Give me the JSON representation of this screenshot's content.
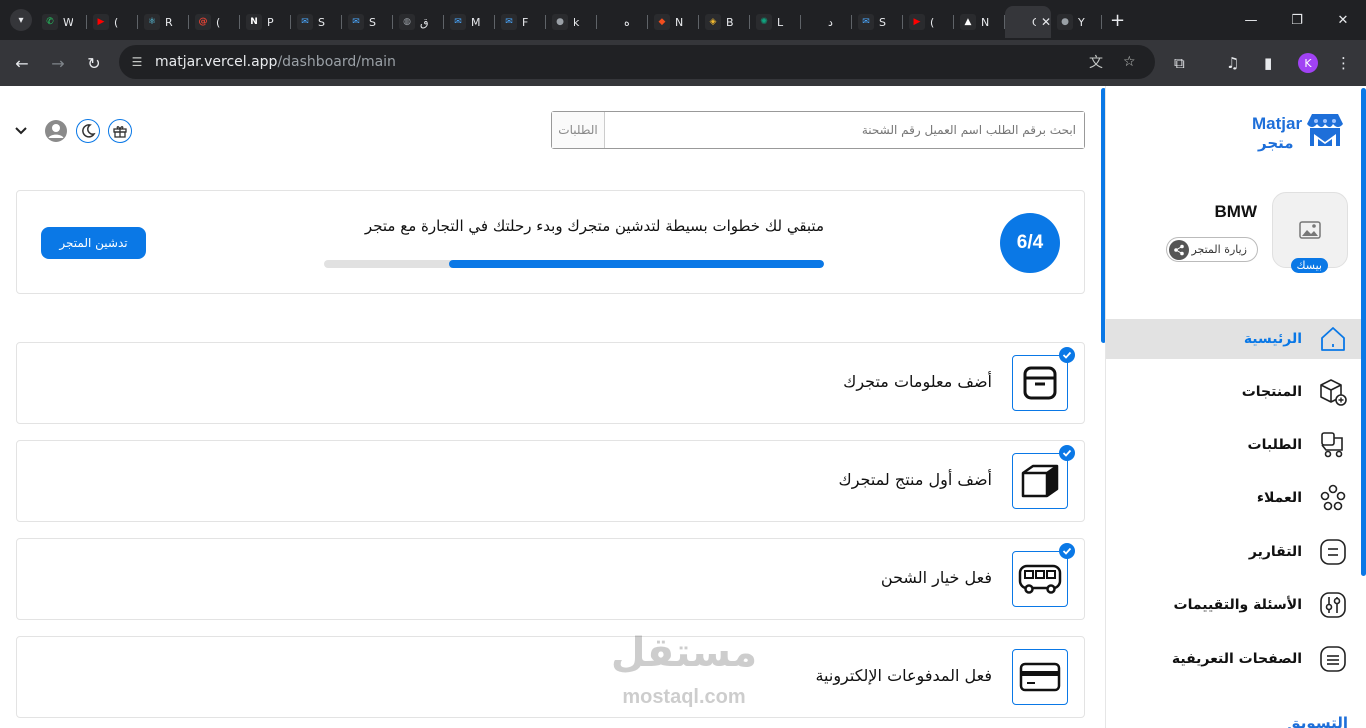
{
  "browser": {
    "tabs": [
      {
        "label": "W",
        "icon": "whatsapp-icon",
        "color": "#25d366"
      },
      {
        "label": "(",
        "icon": "youtube-icon",
        "color": "#ff0000"
      },
      {
        "label": "R",
        "icon": "react-icon",
        "color": "#61dafb"
      },
      {
        "label": "(",
        "icon": "gmail-icon",
        "color": "#ea4335"
      },
      {
        "label": "P",
        "icon": "notion-icon",
        "color": "#ffffff"
      },
      {
        "label": "S",
        "icon": "mail-icon",
        "color": "#4aa8ff"
      },
      {
        "label": "S",
        "icon": "mail-icon",
        "color": "#4aa8ff"
      },
      {
        "label": "ق",
        "icon": "globe-icon",
        "color": "#9aa0a6"
      },
      {
        "label": "M",
        "icon": "mail-icon",
        "color": "#4aa8ff"
      },
      {
        "label": "F",
        "icon": "mail-icon",
        "color": "#4aa8ff"
      },
      {
        "label": "k",
        "icon": "github-icon",
        "color": "#9aa0a6"
      },
      {
        "label": "ه",
        "icon": "blank-icon",
        "color": "#202124"
      },
      {
        "label": "N",
        "icon": "figma-icon",
        "color": "#f24e1e"
      },
      {
        "label": "B",
        "icon": "binance-icon",
        "color": "#f3ba2f"
      },
      {
        "label": "L",
        "icon": "openai-icon",
        "color": "#10a37f"
      },
      {
        "label": "د",
        "icon": "blank-icon",
        "color": "#202124"
      },
      {
        "label": "S",
        "icon": "mail-icon",
        "color": "#4aa8ff"
      },
      {
        "label": "(",
        "icon": "youtube-icon",
        "color": "#ff0000"
      },
      {
        "label": "N",
        "icon": "vercel-icon",
        "color": "#ffffff"
      },
      {
        "label": "C",
        "icon": "blank-icon",
        "color": "#35363a",
        "active": true
      },
      {
        "label": "Y",
        "icon": "github-icon",
        "color": "#9aa0a6"
      }
    ],
    "url_host": "matjar.vercel.app",
    "url_path": "/dashboard/main",
    "profile_initial": "K"
  },
  "brand": {
    "latin": "Matjar",
    "arabic": "متجر",
    "color": "#1e6fd9"
  },
  "store": {
    "name": "BMW",
    "plan": "بيسك",
    "visit_label": "زيارة المتجر"
  },
  "nav": [
    {
      "label": "الرئيسية",
      "icon": "home-icon",
      "active": true
    },
    {
      "label": "المنتجات",
      "icon": "products-box-icon"
    },
    {
      "label": "الطلبات",
      "icon": "orders-cart-icon"
    },
    {
      "label": "العملاء",
      "icon": "customers-icon"
    },
    {
      "label": "التقارير",
      "icon": "reports-icon"
    },
    {
      "label": "الأسئلة والتقييمات",
      "icon": "reviews-sliders-icon"
    },
    {
      "label": "الصفحات التعريفية",
      "icon": "pages-icon"
    }
  ],
  "nav_section": "التسويق",
  "search": {
    "category": "الطلبات",
    "placeholder": "ابحث برقم الطلب اسم العميل رقم الشحنة"
  },
  "launch": {
    "counter": "6/4",
    "text": "متبقي لك خطوات بسيطة لتدشين متجرك وبدء رحلتك في التجارة مع متجر",
    "button": "تدشين المتجر",
    "progress": 0.75
  },
  "steps": [
    {
      "label": "أضف معلومات متجرك",
      "icon": "archive-box-icon",
      "done": true
    },
    {
      "label": "أضف أول منتج لمتجرك",
      "icon": "package-icon",
      "done": true
    },
    {
      "label": "فعل خيار الشحن",
      "icon": "bus-icon",
      "done": true
    },
    {
      "label": "فعل المدفوعات الإلكترونية",
      "icon": "credit-card-icon",
      "done": false
    }
  ],
  "watermark": {
    "arabic": "مستقل",
    "latin": "mostaql.com"
  },
  "colors": {
    "accent": "#0a78e6",
    "nav_active_bg": "#e2e2e2"
  }
}
